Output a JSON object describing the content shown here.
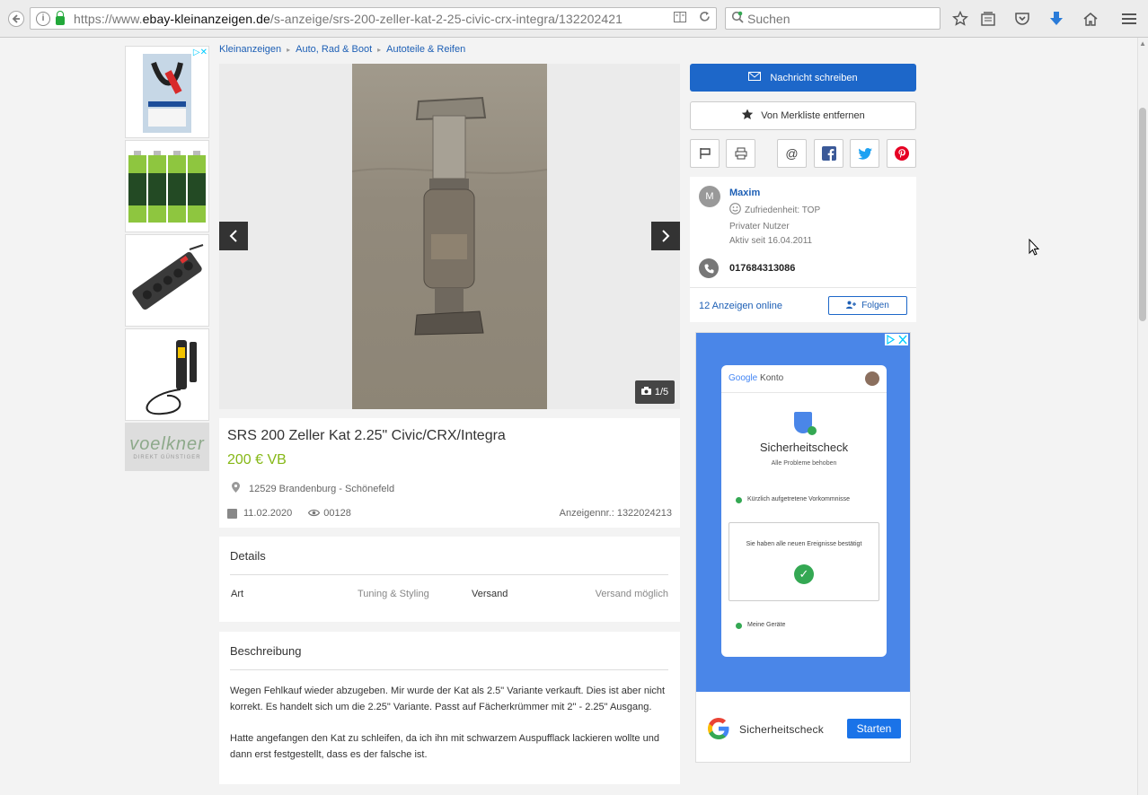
{
  "browser": {
    "url_prefix": "https://www.",
    "url_domain": "ebay-kleinanzeigen.de",
    "url_path": "/s-anzeige/srs-200-zeller-kat-2-25-civic-crx-integra/132202421",
    "search_placeholder": "Suchen"
  },
  "breadcrumb": [
    "Kleinanzeigen",
    "Auto, Rad & Boot",
    "Autoteile & Reifen"
  ],
  "gallery": {
    "counter": "1/5"
  },
  "listing": {
    "title": "SRS 200 Zeller Kat 2.25\" Civic/CRX/Integra",
    "price": "200 € VB",
    "location": "12529 Brandenburg - Schönefeld",
    "date": "11.02.2020",
    "views": "00128",
    "ad_number": "Anzeigennr.: 1322024213"
  },
  "details": {
    "heading": "Details",
    "items": [
      {
        "label": "Art",
        "value": "Tuning & Styling"
      },
      {
        "label": "Versand",
        "value": "Versand möglich"
      }
    ]
  },
  "description": {
    "heading": "Beschreibung",
    "paragraphs": [
      "Wegen Fehlkauf wieder abzugeben. Mir wurde der Kat als 2.5\" Variante verkauft. Dies ist aber nicht korrekt. Es handelt sich um die 2.25\" Variante. Passt auf Fächerkrümmer mit 2\" - 2.25\" Ausgang.",
      "Hatte angefangen den Kat zu schleifen, da ich ihn mit schwarzem Auspufflack lackieren wollte und dann erst festgestellt, dass es der falsche ist."
    ]
  },
  "actions": {
    "message": "Nachricht schreiben",
    "watchlist": "Von Merkliste entfernen"
  },
  "seller": {
    "initial": "M",
    "name": "Maxim",
    "satisfaction": "Zufriedenheit: TOP",
    "type": "Privater Nutzer",
    "since": "Aktiv seit 16.04.2011",
    "phone": "017684313086",
    "ads_online": "12 Anzeigen online",
    "follow": "Folgen"
  },
  "sidebar_ads": {
    "voelkner_brand": "voelkner",
    "voelkner_tagline": "DIREKT GÜNSTIGER"
  },
  "google_ad": {
    "brand": "Google",
    "account": "Konto",
    "title": "Sicherheitscheck",
    "subtitle": "Alle Probleme behoben",
    "item1": "Kürzlich aufgetretene Vorkommnisse",
    "box_text": "Sie haben alle neuen Ereignisse bestätigt",
    "item2": "Meine Geräte",
    "footer_title": "Sicherheitscheck",
    "cta": "Starten"
  },
  "colors": {
    "brand_blue": "#1d67c9",
    "price_green": "#86b817",
    "link_blue": "#1d5fb5",
    "google_ad_bg": "#4a86e8"
  }
}
